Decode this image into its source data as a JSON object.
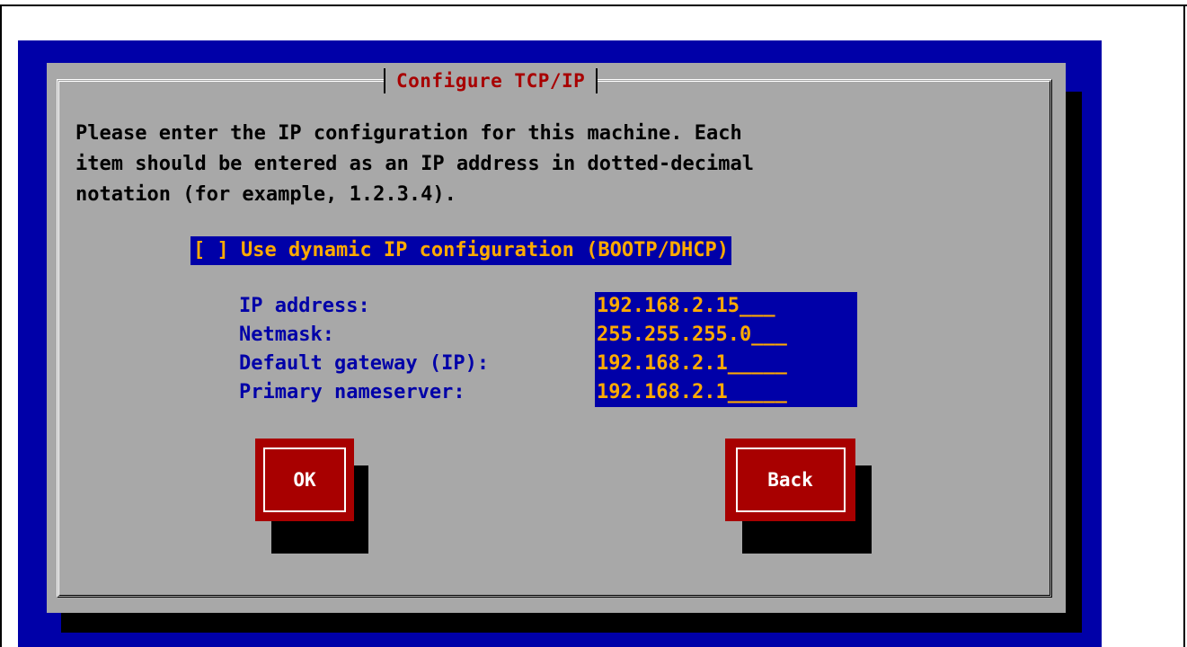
{
  "dialog": {
    "title": "Configure TCP/IP",
    "instructions": "Please enter the IP configuration for this machine. Each\nitem should be entered as an IP address in dotted-decimal\nnotation (for example, 1.2.3.4).",
    "dhcp_checkbox": {
      "label": "[ ] Use dynamic IP configuration (BOOTP/DHCP)",
      "checked": false
    },
    "fields": [
      {
        "label": "IP address:",
        "value": "192.168.2.15___"
      },
      {
        "label": "Netmask:",
        "value": "255.255.255.0___"
      },
      {
        "label": "Default gateway (IP):",
        "value": "192.168.2.1_____"
      },
      {
        "label": "Primary nameserver:",
        "value": "192.168.2.1_____"
      }
    ],
    "buttons": {
      "ok_label": "OK",
      "back_label": "Back"
    }
  },
  "colors": {
    "background": "#0000a8",
    "dialog": "#a8a8a8",
    "title": "#a80000",
    "field_text": "#ffaa00",
    "button": "#a80000"
  }
}
